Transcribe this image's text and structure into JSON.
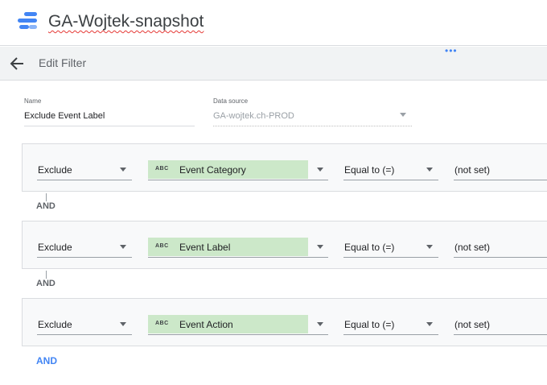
{
  "app": {
    "title": "GA-Wojtek-snapshot"
  },
  "toolbar": {
    "title": "Edit Filter",
    "more_dots": "•••"
  },
  "form": {
    "name_label": "Name",
    "name_value": "Exclude Event Label",
    "datasource_label": "Data source",
    "datasource_value": "GA-wojtek.ch-PROD"
  },
  "conditions": [
    {
      "include": "Exclude",
      "field_type": "ABC",
      "field": "Event Category",
      "operator": "Equal to (=)",
      "value": "(not set)"
    },
    {
      "include": "Exclude",
      "field_type": "ABC",
      "field": "Event Label",
      "operator": "Equal to (=)",
      "value": "(not set)"
    },
    {
      "include": "Exclude",
      "field_type": "ABC",
      "field": "Event Action",
      "operator": "Equal to (=)",
      "value": "(not set)"
    }
  ],
  "and_label": "AND",
  "add_and_label": "AND",
  "colors": {
    "chip": "#cce8c9",
    "accent": "#4285f4",
    "row_bg": "#f8f9fa"
  }
}
